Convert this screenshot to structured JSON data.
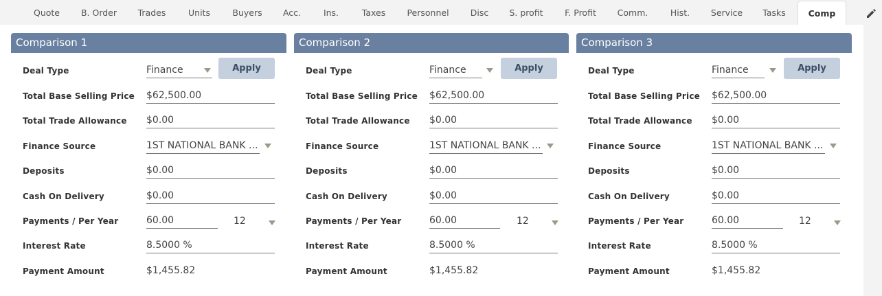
{
  "tabs": [
    {
      "label": "Quote"
    },
    {
      "label": "B. Order"
    },
    {
      "label": "Trades"
    },
    {
      "label": "Units"
    },
    {
      "label": "Buyers"
    },
    {
      "label": "Acc."
    },
    {
      "label": "Ins."
    },
    {
      "label": "Taxes"
    },
    {
      "label": "Personnel"
    },
    {
      "label": "Disc"
    },
    {
      "label": "S. profit"
    },
    {
      "label": "F. Profit"
    },
    {
      "label": "Comm."
    },
    {
      "label": "Hist."
    },
    {
      "label": "Service"
    },
    {
      "label": "Tasks"
    },
    {
      "label": "Comp"
    }
  ],
  "active_tab": "Comp",
  "labels": {
    "deal_type": "Deal Type",
    "total_base_selling_price": "Total Base Selling Price",
    "total_trade_allowance": "Total Trade Allowance",
    "finance_source": "Finance Source",
    "deposits": "Deposits",
    "cash_on_delivery": "Cash On Delivery",
    "payments_per_year": "Payments / Per Year",
    "interest_rate": "Interest Rate",
    "payment_amount": "Payment Amount",
    "apply": "Apply"
  },
  "comparisons": [
    {
      "title": "Comparison 1",
      "deal_type": "Finance",
      "total_base_selling_price": "$62,500.00",
      "total_trade_allowance": "$0.00",
      "finance_source": "1ST NATIONAL BANK ...",
      "deposits": "$0.00",
      "cash_on_delivery": "$0.00",
      "payments": "60.00",
      "per_year": "12",
      "interest_rate": "8.5000 %",
      "payment_amount": "$1,455.82"
    },
    {
      "title": "Comparison 2",
      "deal_type": "Finance",
      "total_base_selling_price": "$62,500.00",
      "total_trade_allowance": "$0.00",
      "finance_source": "1ST NATIONAL BANK ...",
      "deposits": "$0.00",
      "cash_on_delivery": "$0.00",
      "payments": "60.00",
      "per_year": "12",
      "interest_rate": "8.5000 %",
      "payment_amount": "$1,455.82"
    },
    {
      "title": "Comparison 3",
      "deal_type": "Finance",
      "total_base_selling_price": "$62,500.00",
      "total_trade_allowance": "$0.00",
      "finance_source": "1ST NATIONAL BANK ...",
      "deposits": "$0.00",
      "cash_on_delivery": "$0.00",
      "payments": "60.00",
      "per_year": "12",
      "interest_rate": "8.5000 %",
      "payment_amount": "$1,455.82"
    }
  ],
  "icons": {
    "edit": "pencil-icon",
    "dropdown": "chevron-down-icon"
  },
  "colors": {
    "header": "#6a80a0",
    "apply_button": "#c4d0de",
    "panel_bg": "#ffffff",
    "page_bg": "#f3f3f3"
  }
}
